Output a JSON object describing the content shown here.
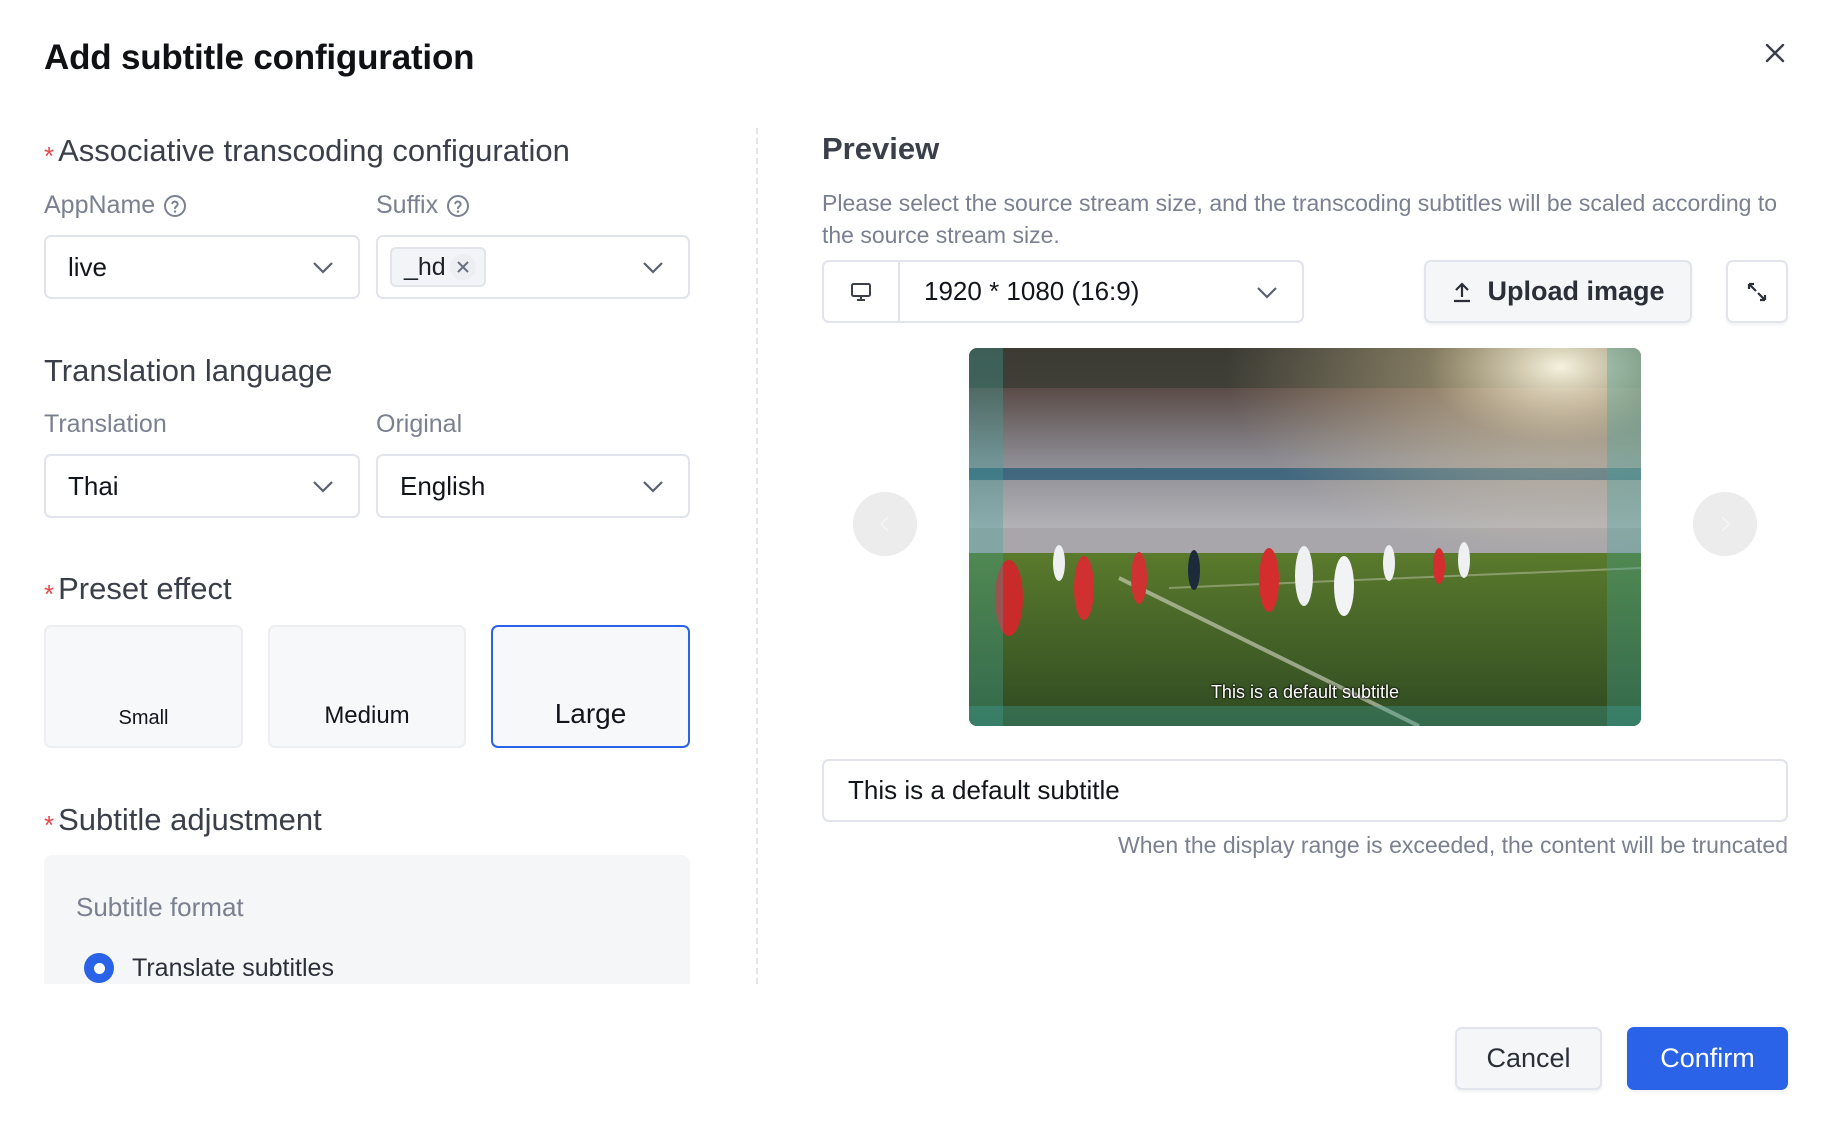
{
  "dialog": {
    "title": "Add subtitle configuration",
    "close_icon": "close-icon"
  },
  "left": {
    "transcoding": {
      "title": "Associative transcoding configuration",
      "required": "*",
      "appname_label": "AppName",
      "appname_value": "live",
      "suffix_label": "Suffix",
      "suffix_tags": [
        "_hd"
      ]
    },
    "translation": {
      "title": "Translation language",
      "translation_label": "Translation",
      "translation_value": "Thai",
      "original_label": "Original",
      "original_value": "English"
    },
    "preset": {
      "title": "Preset effect",
      "required": "*",
      "options": [
        {
          "label": "Small",
          "selected": false
        },
        {
          "label": "Medium",
          "selected": false
        },
        {
          "label": "Large",
          "selected": true
        }
      ]
    },
    "adjustment": {
      "title": "Subtitle adjustment",
      "required": "*",
      "format_label": "Subtitle format",
      "format_options": [
        {
          "label": "Translate subtitles",
          "selected": true
        }
      ]
    }
  },
  "preview": {
    "title": "Preview",
    "description": "Please select the source stream size, and the transcoding subtitles will be scaled according to the source stream size.",
    "size_icon": "monitor-icon",
    "size_value": "1920 * 1080 (16:9)",
    "upload_label": "Upload image",
    "upload_icon": "upload-icon",
    "expand_icon": "expand-icon",
    "overlay_subtitle": "This is a default subtitle",
    "subtitle_input_value": "This is a default subtitle",
    "hint": "When the display range is exceeded, the content will be truncated"
  },
  "footer": {
    "cancel_label": "Cancel",
    "confirm_label": "Confirm"
  },
  "colors": {
    "accent": "#2a63e8",
    "required": "#e5484d"
  }
}
